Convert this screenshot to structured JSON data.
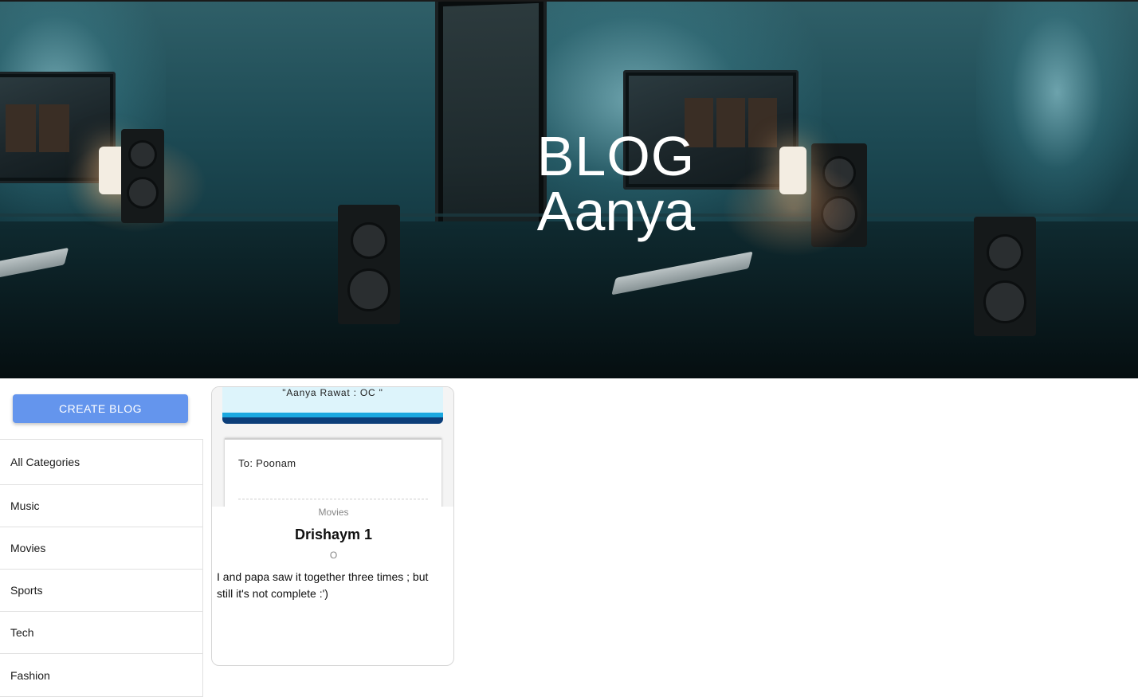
{
  "hero": {
    "title_line1": "BLOG",
    "title_line2": "Aanya"
  },
  "sidebar": {
    "create_button_label": "CREATE BLOG",
    "categories": [
      "All Categories",
      "Music",
      "Movies",
      "Sports",
      "Tech",
      "Fashion"
    ]
  },
  "posts": [
    {
      "thumbnail": {
        "header_quote": "\"Aanya Rawat : OC \"",
        "to_line": "To: Poonam"
      },
      "category": "Movies",
      "title": "Drishaym 1",
      "author": "O",
      "description": "I and papa saw it together three times ; but still it's not complete :')"
    }
  ],
  "colors": {
    "accent": "#6495ed",
    "hero_text": "#ffffff",
    "muted_text": "#878787"
  }
}
